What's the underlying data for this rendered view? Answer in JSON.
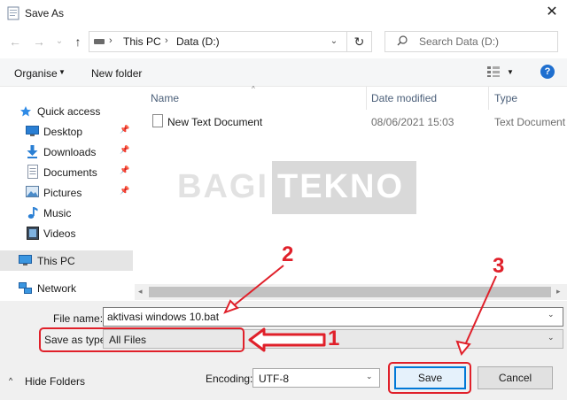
{
  "window": {
    "title": "Save As",
    "close_glyph": "✕"
  },
  "address": {
    "crumbs": [
      "This PC",
      "Data (D:)"
    ],
    "separator": "›",
    "refresh_glyph": "↻",
    "dropdown_glyph": "⌄"
  },
  "search": {
    "placeholder": "Search Data (D:)"
  },
  "nav_buttons": {
    "back": "←",
    "forward": "→",
    "recent": "⌄",
    "up": "↑"
  },
  "toolbar": {
    "organise_label": "Organise",
    "organise_arrow": "▼",
    "new_folder_label": "New folder",
    "view_arrow": "▼",
    "help_glyph": "?"
  },
  "sidebar": {
    "quick_access": "Quick access",
    "items": [
      {
        "label": "Desktop",
        "icon": "desktop-icon",
        "pinned": true
      },
      {
        "label": "Downloads",
        "icon": "download-icon",
        "pinned": true
      },
      {
        "label": "Documents",
        "icon": "documents-icon",
        "pinned": true
      },
      {
        "label": "Pictures",
        "icon": "pictures-icon",
        "pinned": true
      },
      {
        "label": "Music",
        "icon": "music-icon",
        "pinned": false
      },
      {
        "label": "Videos",
        "icon": "videos-icon",
        "pinned": false
      }
    ],
    "this_pc": "This PC",
    "network": "Network",
    "pin_glyph": "📌"
  },
  "file_list": {
    "columns": [
      "Name",
      "Date modified",
      "Type"
    ],
    "sort_caret": "^",
    "rows": [
      {
        "name": "New Text Document",
        "date": "08/06/2021 15:03",
        "type": "Text Document"
      }
    ]
  },
  "watermark": {
    "left": "BAGI",
    "right": "TEKNO"
  },
  "scroll": {
    "left_arrow": "◂",
    "right_arrow": "▸"
  },
  "form": {
    "file_name_label": "File name:",
    "file_name_value": "aktivasi windows 10.bat",
    "save_as_type_label": "Save as type:",
    "save_as_type_value": "All Files",
    "dropdown_glyph": "⌄",
    "encoding_label": "Encoding:",
    "encoding_value": "UTF-8"
  },
  "footer": {
    "hide_folders_label": "Hide Folders",
    "hide_caret": "^",
    "save_label": "Save",
    "cancel_label": "Cancel"
  },
  "annotations": {
    "n1": "1",
    "n2": "2",
    "n3": "3",
    "color": "#e0202a"
  },
  "colors": {
    "accent": "#0078d7",
    "selection": "#e5e5e5",
    "annotation_red": "#e0202a",
    "help_blue": "#1f6fcf"
  }
}
